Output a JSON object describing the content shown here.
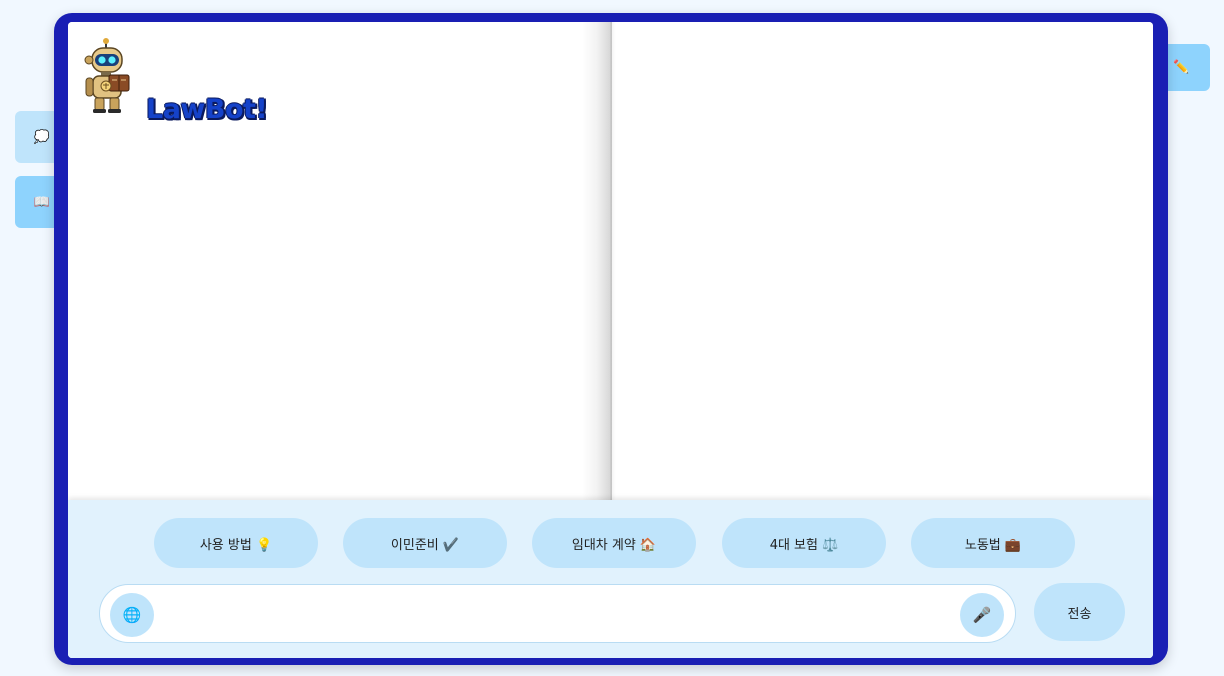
{
  "logo": {
    "text": "LawBot!"
  },
  "side_tabs": {
    "chat_icon": "💭",
    "book_icon": "📖",
    "edit_icon": "✏️"
  },
  "quick_actions": [
    {
      "label": "사용 방법 💡"
    },
    {
      "label": "이민준비 ✔️"
    },
    {
      "label": "임대차 계약 🏠"
    },
    {
      "label": "4대 보험 ⚖️"
    },
    {
      "label": "노동법 💼"
    }
  ],
  "input": {
    "value": "",
    "placeholder": "",
    "globe_icon": "🌐",
    "mic_icon": "🎤"
  },
  "send_label": "전송",
  "colors": {
    "frame": "#1a1fb4",
    "accent": "#bfe4fb",
    "accent_strong": "#8ed3fd",
    "panel": "#e1f2fd"
  }
}
